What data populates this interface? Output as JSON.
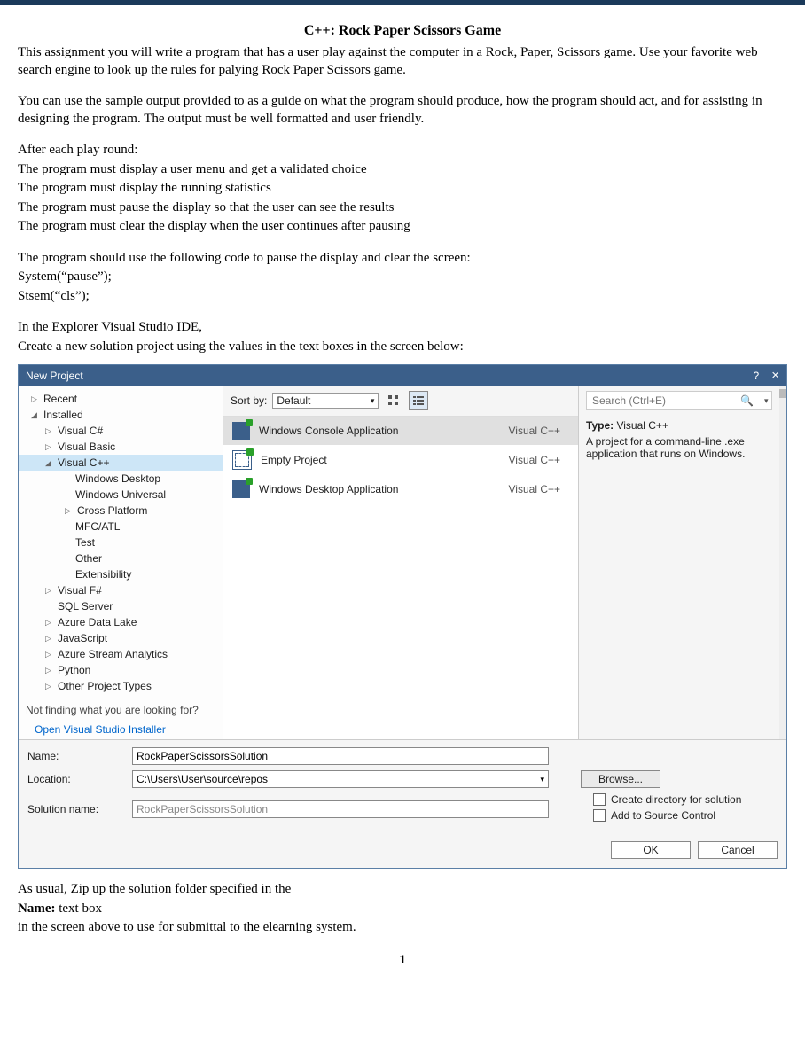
{
  "doc": {
    "title": "C++: Rock Paper Scissors Game",
    "p1": "This assignment you will write a program that has a user play against the computer in a Rock, Paper, Scissors game. Use your favorite web search engine to look up the rules for palying Rock Paper Scissors game.",
    "p2": "You can use the sample output provided  to as a guide on what the program should produce, how the program should act, and for assisting in designing the program.  The output must be well formatted and user friendly.",
    "p3": "After each play round:",
    "p4": "The program must display a user menu and get a validated choice",
    "p5": "The program must display the running statistics",
    "p6": "The program must pause the display so that the user can see the results",
    "p7": "The program must clear the display when the user continues after pausing",
    "p8": "The program should use the following code to pause the display and clear the screen:",
    "p9": "System(“pause”);",
    "p10": "Stsem(“cls”);",
    "p11": "In the Explorer Visual Studio IDE,",
    "p12": "Create a new solution project using the values in the text boxes in the screen below:",
    "post1": "As usual, Zip up the solution folder specified in the",
    "post2a": "Name:",
    "post2b": " text box",
    "post3": "in the screen above to use for submittal to the elearning system.",
    "pagenum": "1"
  },
  "vs": {
    "title": "New Project",
    "help": "?",
    "close": "×",
    "tree": {
      "recent": "Recent",
      "installed": "Installed",
      "vcsharp": "Visual C#",
      "vbasic": "Visual Basic",
      "vcpp": "Visual C++",
      "wdesktop": "Windows Desktop",
      "wuniversal": "Windows Universal",
      "crossplat": "Cross Platform",
      "mfc": "MFC/ATL",
      "test": "Test",
      "other": "Other",
      "ext": "Extensibility",
      "vfsharp": "Visual F#",
      "sql": "SQL Server",
      "adl": "Azure Data Lake",
      "js": "JavaScript",
      "asa": "Azure Stream Analytics",
      "py": "Python",
      "opt": "Other Project Types",
      "notfinding": "Not finding what you are looking for?",
      "openinstaller": "Open Visual Studio Installer"
    },
    "sort": {
      "label": "Sort by:",
      "value": "Default"
    },
    "templates": {
      "t1": {
        "name": "Windows Console Application",
        "lang": "Visual C++"
      },
      "t2": {
        "name": "Empty Project",
        "lang": "Visual C++"
      },
      "t3": {
        "name": "Windows Desktop Application",
        "lang": "Visual C++"
      }
    },
    "right": {
      "search_placeholder": "Search (Ctrl+E)",
      "type_label": "Type:",
      "type_value": "Visual C++",
      "desc": "A project for a command-line .exe application that runs on Windows."
    },
    "form": {
      "name_label": "Name:",
      "name_value": "RockPaperScissorsSolution",
      "loc_label": "Location:",
      "loc_value": "C:\\Users\\User\\source\\repos",
      "sol_label": "Solution name:",
      "sol_value": "RockPaperScissorsSolution",
      "browse": "Browse...",
      "chk1": "Create directory for solution",
      "chk2": "Add to Source Control",
      "ok": "OK",
      "cancel": "Cancel"
    }
  }
}
